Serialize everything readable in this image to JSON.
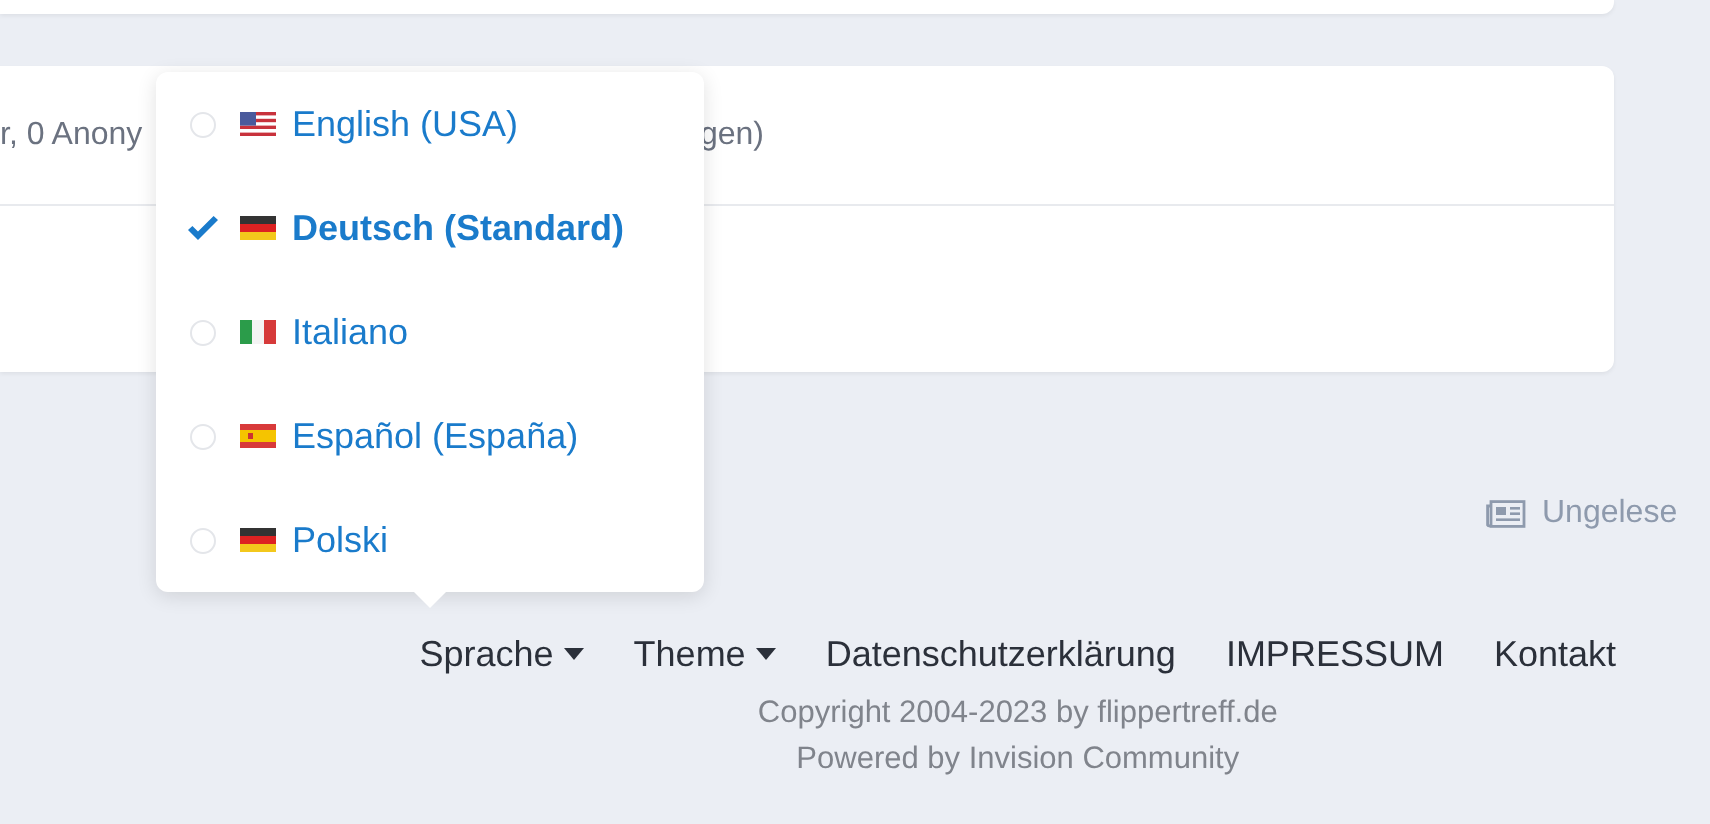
{
  "online_card": {
    "summary_left": "r, 0 Anony",
    "summary_right": "gen)"
  },
  "unread_link": {
    "label": "Ungelese"
  },
  "language_menu": {
    "items": [
      {
        "label": "English (USA)",
        "kind": "us",
        "selected": false
      },
      {
        "label": "Deutsch (Standard)",
        "kind": "de",
        "selected": true
      },
      {
        "label": "Italiano",
        "kind": "it",
        "selected": false
      },
      {
        "label": "Español (España)",
        "kind": "es",
        "selected": false
      },
      {
        "label": "Polski",
        "kind": "de",
        "selected": false
      }
    ]
  },
  "footer": {
    "links": [
      {
        "label": "Sprache",
        "dropdown": true
      },
      {
        "label": "Theme",
        "dropdown": true
      },
      {
        "label": "Datenschutzerklärung",
        "dropdown": false
      },
      {
        "label": "IMPRESSUM",
        "dropdown": false
      },
      {
        "label": "Kontakt",
        "dropdown": false
      }
    ],
    "copyright": "Copyright 2004-2023 by flippertreff.de",
    "powered_by": "Powered by Invision Community"
  }
}
